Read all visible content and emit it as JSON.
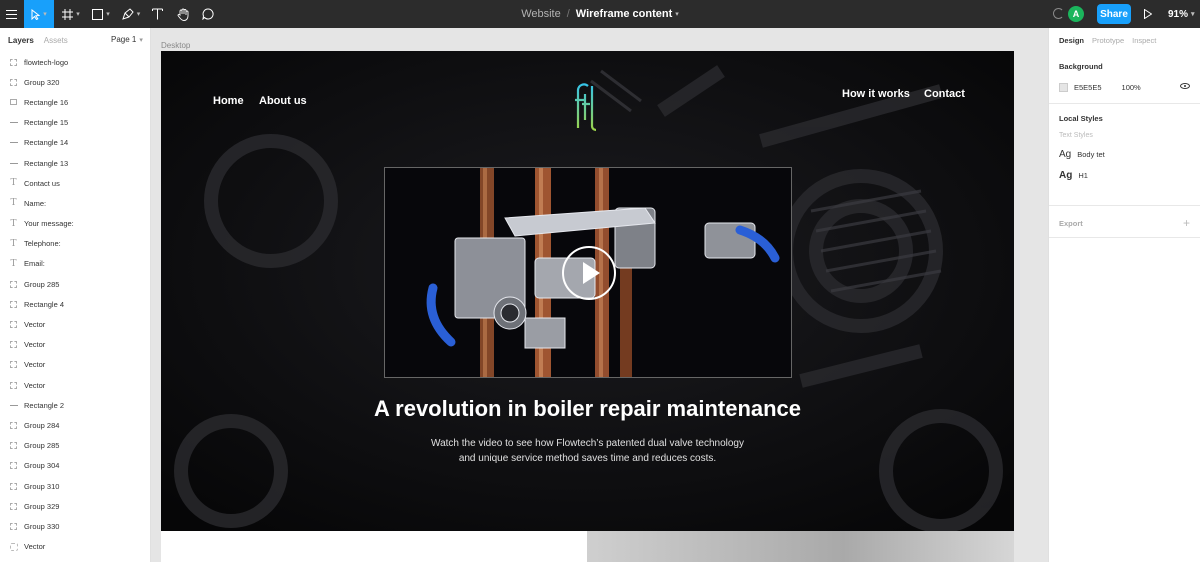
{
  "toolbar": {
    "breadcrumb_project": "Website",
    "breadcrumb_separator": "/",
    "file_name": "Wireframe content",
    "avatar_initial": "A",
    "share_label": "Share",
    "zoom_level": "91%",
    "icons": [
      "menu-icon",
      "move-tool-icon",
      "frame-tool-icon",
      "shape-tool-icon",
      "pen-tool-icon",
      "text-tool-icon",
      "hand-tool-icon",
      "comment-tool-icon",
      "present-icon"
    ]
  },
  "left_panel": {
    "tabs": [
      "Layers",
      "Assets"
    ],
    "page_selector": "Page 1",
    "layers": [
      {
        "name": "flowtech-logo",
        "type": "frame"
      },
      {
        "name": "Group 320",
        "type": "frame"
      },
      {
        "name": "Rectangle 16",
        "type": "rect"
      },
      {
        "name": "Rectangle 15",
        "type": "line"
      },
      {
        "name": "Rectangle 14",
        "type": "line"
      },
      {
        "name": "Rectangle 13",
        "type": "line"
      },
      {
        "name": "Contact us",
        "type": "text"
      },
      {
        "name": "Name:",
        "type": "text"
      },
      {
        "name": "Your message:",
        "type": "text"
      },
      {
        "name": "Telephone:",
        "type": "text"
      },
      {
        "name": "Email:",
        "type": "text"
      },
      {
        "name": "Group 285",
        "type": "frame"
      },
      {
        "name": "Rectangle 4",
        "type": "frame"
      },
      {
        "name": "Vector",
        "type": "frame"
      },
      {
        "name": "Vector",
        "type": "frame"
      },
      {
        "name": "Vector",
        "type": "frame"
      },
      {
        "name": "Vector",
        "type": "frame"
      },
      {
        "name": "Rectangle 2",
        "type": "line"
      },
      {
        "name": "Group 284",
        "type": "frame"
      },
      {
        "name": "Group 285",
        "type": "frame"
      },
      {
        "name": "Group 304",
        "type": "frame"
      },
      {
        "name": "Group 310",
        "type": "frame"
      },
      {
        "name": "Group 329",
        "type": "frame"
      },
      {
        "name": "Group 330",
        "type": "frame"
      },
      {
        "name": "Vector",
        "type": "vector"
      }
    ]
  },
  "canvas": {
    "frame_label": "Desktop",
    "nav": {
      "home": "Home",
      "about": "About us",
      "how_it_works": "How it works",
      "contact": "Contact"
    },
    "logo_text": "ftl",
    "hero_title": "A revolution in boiler repair maintenance",
    "hero_sub_line1": "Watch the video to see how Flowtech’s patented dual valve technology",
    "hero_sub_line2": "and unique service method saves time and reduces costs."
  },
  "right_panel": {
    "tabs": [
      "Design",
      "Prototype",
      "Inspect"
    ],
    "background_heading": "Background",
    "background_hex": "E5E5E5",
    "background_opacity": "100%",
    "local_styles_heading": "Local Styles",
    "text_styles_label": "Text Styles",
    "styles": [
      {
        "sample": "Ag",
        "name": "Body tet"
      },
      {
        "sample": "Ag",
        "name": "H1"
      }
    ],
    "export_heading": "Export",
    "export_add": "+"
  },
  "colors": {
    "toolbar_bg": "#2c2c2c",
    "accent_blue": "#18a0fb",
    "avatar_green": "#1bb55c",
    "hero_bg": "#0b0b0d",
    "canvas_bg": "#e5e5e5"
  }
}
